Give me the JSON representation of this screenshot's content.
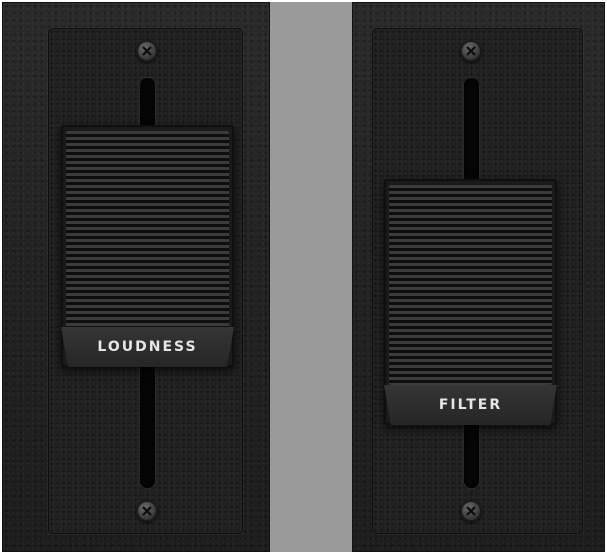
{
  "sliders": [
    {
      "label": "LOUDNESS",
      "position": 0.25
    },
    {
      "label": "FILTER",
      "position": 0.4
    }
  ],
  "colors": {
    "divider": "#9a9a9a",
    "panel": "#222222",
    "label_text": "#e6e6e6"
  },
  "icons": [
    "screw-icon"
  ]
}
